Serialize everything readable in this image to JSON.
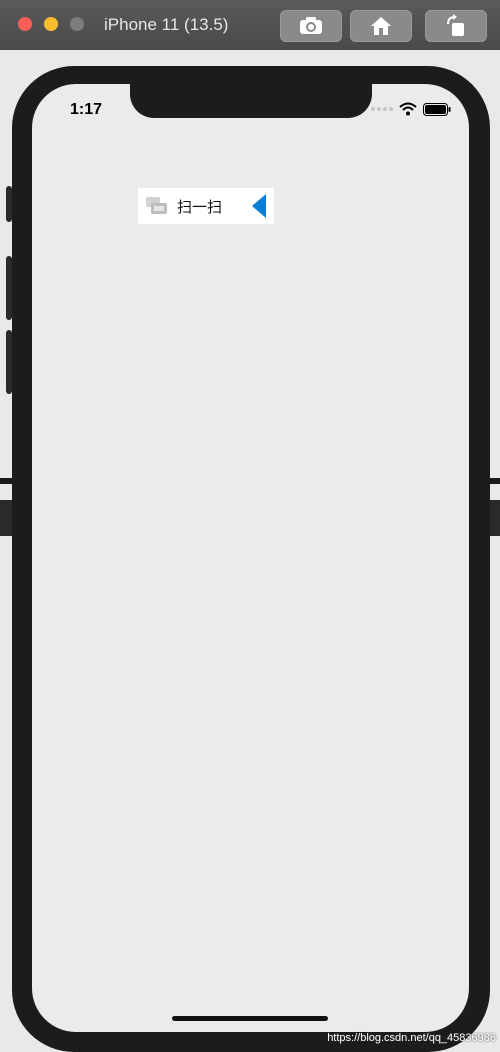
{
  "simulator": {
    "title": "iPhone 11 (13.5)",
    "buttons": [
      "screenshot-icon",
      "home-icon",
      "rotate-icon"
    ]
  },
  "status_bar": {
    "time": "1:17"
  },
  "popup": {
    "icon": "scan-icon",
    "label": "扫一扫",
    "arrow_color": "#0b7fd8"
  },
  "watermark": "https://blog.csdn.net/qq_45836986"
}
